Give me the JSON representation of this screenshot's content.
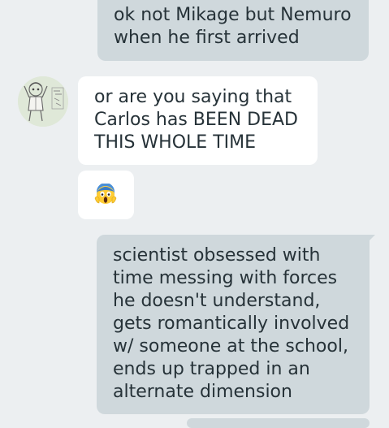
{
  "conversation": {
    "messages": [
      {
        "direction": "outgoing",
        "text": "ok not Mikage but Nemuro\nwhen he first arrived"
      },
      {
        "direction": "incoming",
        "sender_avatar": "sketch-avatar",
        "text": "or are you saying that\nCarlos has BEEN DEAD\nTHIS WHOLE TIME"
      },
      {
        "direction": "incoming",
        "emoji": "screaming-face-emoji"
      },
      {
        "direction": "outgoing",
        "text": "scientist obsessed with\ntime messing with forces\nhe doesn't understand,\ngets romantically involved\nw/ someone at the school,\nends up trapped in an\nalternate dimension"
      }
    ]
  },
  "colors": {
    "background": "#eceff1",
    "outgoing_bubble": "#cfd8dc",
    "incoming_bubble": "#ffffff",
    "text": "#263238"
  }
}
